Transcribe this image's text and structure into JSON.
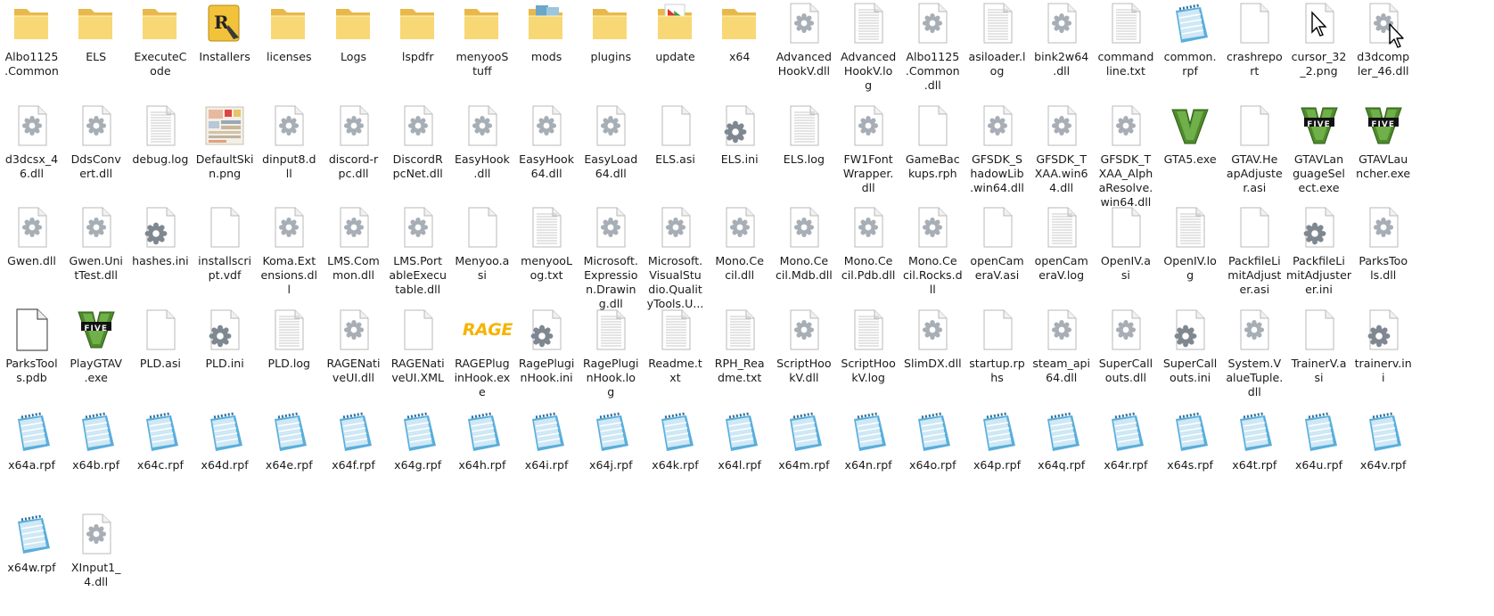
{
  "items": [
    {
      "label": "Albo1125\n.Common",
      "icon": "folder-icon"
    },
    {
      "label": "ELS",
      "icon": "folder-icon"
    },
    {
      "label": "ExecuteC\node",
      "icon": "folder-icon"
    },
    {
      "label": "Installers",
      "icon": "installers-folder-icon"
    },
    {
      "label": "licenses",
      "icon": "folder-icon"
    },
    {
      "label": "Logs",
      "icon": "folder-icon"
    },
    {
      "label": "lspdfr",
      "icon": "folder-icon"
    },
    {
      "label": "menyooS\ntuff",
      "icon": "folder-icon"
    },
    {
      "label": "mods",
      "icon": "mods-folder-icon"
    },
    {
      "label": "plugins",
      "icon": "folder-icon"
    },
    {
      "label": "update",
      "icon": "update-folder-icon"
    },
    {
      "label": "x64",
      "icon": "folder-icon"
    },
    {
      "label": "Advanced\nHookV.dll",
      "icon": "dll-file-icon"
    },
    {
      "label": "Advanced\nHookV.lo\ng",
      "icon": "text-file-icon"
    },
    {
      "label": "Albo1125\n.Common\n.dll",
      "icon": "dll-file-icon"
    },
    {
      "label": "asiloader.l\nog",
      "icon": "text-file-icon"
    },
    {
      "label": "bink2w64\n.dll",
      "icon": "dll-file-icon"
    },
    {
      "label": "command\nline.txt",
      "icon": "text-file-icon"
    },
    {
      "label": "common.\nrpf",
      "icon": "notepad-file-icon"
    },
    {
      "label": "crashrepo\nrt",
      "icon": "blank-file-icon"
    },
    {
      "label": "cursor_32\n_2.png",
      "icon": "cursor-image-icon"
    },
    {
      "label": "d3dcomp\nler_46.dll",
      "icon": "dll-file-icon"
    },
    {
      "label": "d3dcsx_4\n6.dll",
      "icon": "dll-file-icon"
    },
    {
      "label": "DdsConv\nert.dll",
      "icon": "dll-file-icon"
    },
    {
      "label": "debug.log",
      "icon": "text-file-icon"
    },
    {
      "label": "DefaultSki\nn.png",
      "icon": "png-image-icon"
    },
    {
      "label": "dinput8.d\nll",
      "icon": "dll-file-icon"
    },
    {
      "label": "discord-r\npc.dll",
      "icon": "dll-file-icon"
    },
    {
      "label": "DiscordR\npcNet.dll",
      "icon": "dll-file-icon"
    },
    {
      "label": "EasyHook\n.dll",
      "icon": "dll-file-icon"
    },
    {
      "label": "EasyHook\n64.dll",
      "icon": "dll-file-icon"
    },
    {
      "label": "EasyLoad\n64.dll",
      "icon": "dll-file-icon"
    },
    {
      "label": "ELS.asi",
      "icon": "blank-file-icon"
    },
    {
      "label": "ELS.ini",
      "icon": "settings-file-icon"
    },
    {
      "label": "ELS.log",
      "icon": "text-file-icon"
    },
    {
      "label": "FW1Font\nWrapper.\ndll",
      "icon": "dll-file-icon"
    },
    {
      "label": "GameBac\nkups.rph",
      "icon": "blank-file-icon"
    },
    {
      "label": "GFSDK_S\nhadowLib\n.win64.dll",
      "icon": "dll-file-icon"
    },
    {
      "label": "GFSDK_T\nXAA.win6\n4.dll",
      "icon": "dll-file-icon"
    },
    {
      "label": "GFSDK_T\nXAA_Alph\naResolve.\nwin64.dll",
      "icon": "dll-file-icon"
    },
    {
      "label": "GTA5.exe",
      "icon": "gta-v-logo-icon"
    },
    {
      "label": "GTAV.He\napAdjuste\nr.asi",
      "icon": "blank-file-icon"
    },
    {
      "label": "GTAVLan\nguageSel\nect.exe",
      "icon": "gta-five-logo-icon"
    },
    {
      "label": "GTAVLau\nncher.exe",
      "icon": "gta-five-logo-icon"
    },
    {
      "label": "Gwen.dll",
      "icon": "dll-file-icon"
    },
    {
      "label": "Gwen.Uni\ntTest.dll",
      "icon": "dll-file-icon"
    },
    {
      "label": "hashes.ini",
      "icon": "settings-file-icon"
    },
    {
      "label": "installscri\npt.vdf",
      "icon": "blank-file-icon"
    },
    {
      "label": "Koma.Ext\nensions.dl\nl",
      "icon": "dll-file-icon"
    },
    {
      "label": "LMS.Com\nmon.dll",
      "icon": "dll-file-icon"
    },
    {
      "label": "LMS.Port\nableExecu\ntable.dll",
      "icon": "dll-file-icon"
    },
    {
      "label": "Menyoo.a\nsi",
      "icon": "blank-file-icon"
    },
    {
      "label": "menyooL\nog.txt",
      "icon": "text-file-icon"
    },
    {
      "label": "Microsoft.\nExpressio\nn.Drawin\ng.dll",
      "icon": "dll-file-icon"
    },
    {
      "label": "Microsoft.\nVisualStu\ndio.Qualit\nyTools.U...",
      "icon": "dll-file-icon"
    },
    {
      "label": "Mono.Ce\ncil.dll",
      "icon": "dll-file-icon"
    },
    {
      "label": "Mono.Ce\ncil.Mdb.dll",
      "icon": "dll-file-icon"
    },
    {
      "label": "Mono.Ce\ncil.Pdb.dll",
      "icon": "dll-file-icon"
    },
    {
      "label": "Mono.Ce\ncil.Rocks.d\nll",
      "icon": "dll-file-icon"
    },
    {
      "label": "openCam\neraV.asi",
      "icon": "blank-file-icon"
    },
    {
      "label": "openCam\neraV.log",
      "icon": "text-file-icon"
    },
    {
      "label": "OpenIV.a\nsi",
      "icon": "blank-file-icon"
    },
    {
      "label": "OpenIV.lo\ng",
      "icon": "text-file-icon"
    },
    {
      "label": "PackfileLi\nmitAdjust\ner.asi",
      "icon": "blank-file-icon"
    },
    {
      "label": "PackfileLi\nmitAdjuster\ner.ini",
      "icon": "settings-file-icon"
    },
    {
      "label": "ParksToo\nls.dll",
      "icon": "dll-file-icon"
    },
    {
      "label": "ParksTool\ns.pdb",
      "icon": "pdb-file-icon"
    },
    {
      "label": "PlayGTAV\n.exe",
      "icon": "gta-five-logo-icon"
    },
    {
      "label": "PLD.asi",
      "icon": "blank-file-icon"
    },
    {
      "label": "PLD.ini",
      "icon": "settings-file-icon"
    },
    {
      "label": "PLD.log",
      "icon": "text-file-icon"
    },
    {
      "label": "RAGENati\nveUI.dll",
      "icon": "dll-file-icon"
    },
    {
      "label": "RAGENati\nveUI.XML",
      "icon": "blank-file-icon"
    },
    {
      "label": "RAGEPlug\ninHook.ex\ne",
      "icon": "rage-logo-icon"
    },
    {
      "label": "RagePlugi\nnHook.ini",
      "icon": "settings-file-icon"
    },
    {
      "label": "RagePlugi\nnHook.lo\ng",
      "icon": "text-file-icon"
    },
    {
      "label": "Readme.t\nxt",
      "icon": "text-file-icon"
    },
    {
      "label": "RPH_Rea\ndme.txt",
      "icon": "text-file-icon"
    },
    {
      "label": "ScriptHoo\nkV.dll",
      "icon": "dll-file-icon"
    },
    {
      "label": "ScriptHoo\nkV.log",
      "icon": "text-file-icon"
    },
    {
      "label": "SlimDX.dll",
      "icon": "dll-file-icon"
    },
    {
      "label": "startup.rp\nhs",
      "icon": "blank-file-icon"
    },
    {
      "label": "steam_api\n64.dll",
      "icon": "dll-file-icon"
    },
    {
      "label": "SuperCall\nouts.dll",
      "icon": "dll-file-icon"
    },
    {
      "label": "SuperCall\nouts.ini",
      "icon": "settings-file-icon"
    },
    {
      "label": "System.V\nalueTuple.\ndll",
      "icon": "dll-file-icon"
    },
    {
      "label": "TrainerV.a\nsi",
      "icon": "blank-file-icon"
    },
    {
      "label": "trainerv.in\ni",
      "icon": "settings-file-icon"
    },
    {
      "label": "x64a.rpf",
      "icon": "notepad-file-icon"
    },
    {
      "label": "x64b.rpf",
      "icon": "notepad-file-icon"
    },
    {
      "label": "x64c.rpf",
      "icon": "notepad-file-icon"
    },
    {
      "label": "x64d.rpf",
      "icon": "notepad-file-icon"
    },
    {
      "label": "x64e.rpf",
      "icon": "notepad-file-icon"
    },
    {
      "label": "x64f.rpf",
      "icon": "notepad-file-icon"
    },
    {
      "label": "x64g.rpf",
      "icon": "notepad-file-icon"
    },
    {
      "label": "x64h.rpf",
      "icon": "notepad-file-icon"
    },
    {
      "label": "x64i.rpf",
      "icon": "notepad-file-icon"
    },
    {
      "label": "x64j.rpf",
      "icon": "notepad-file-icon"
    },
    {
      "label": "x64k.rpf",
      "icon": "notepad-file-icon"
    },
    {
      "label": "x64l.rpf",
      "icon": "notepad-file-icon"
    },
    {
      "label": "x64m.rpf",
      "icon": "notepad-file-icon"
    },
    {
      "label": "x64n.rpf",
      "icon": "notepad-file-icon"
    },
    {
      "label": "x64o.rpf",
      "icon": "notepad-file-icon"
    },
    {
      "label": "x64p.rpf",
      "icon": "notepad-file-icon"
    },
    {
      "label": "x64q.rpf",
      "icon": "notepad-file-icon"
    },
    {
      "label": "x64r.rpf",
      "icon": "notepad-file-icon"
    },
    {
      "label": "x64s.rpf",
      "icon": "notepad-file-icon"
    },
    {
      "label": "x64t.rpf",
      "icon": "notepad-file-icon"
    },
    {
      "label": "x64u.rpf",
      "icon": "notepad-file-icon"
    },
    {
      "label": "x64v.rpf",
      "icon": "notepad-file-icon"
    },
    {
      "label": "x64w.rpf",
      "icon": "notepad-file-icon"
    },
    {
      "label": "XInput1_\n4.dll",
      "icon": "dll-file-icon"
    }
  ],
  "colors": {
    "folder": "#f8d775",
    "folder_dark": "#e8b94a",
    "gear": "#a7aeb6",
    "notepad": "#5aaedc",
    "gta_green": "#4f8a2b",
    "rage": "#f5b400"
  },
  "rage_logo_text": "RAGE",
  "gta_logo_letter": "V",
  "gta_logo_word": "FIVE"
}
